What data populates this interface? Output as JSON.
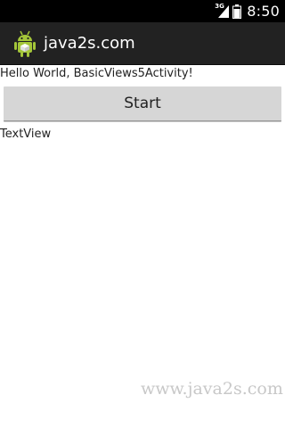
{
  "status_bar": {
    "network_type": "3G",
    "time": "8:50",
    "icons": [
      "signal-icon",
      "battery-icon"
    ]
  },
  "action_bar": {
    "app_icon": "android-robot-icon",
    "title": "java2s.com"
  },
  "content": {
    "hello_text": "Hello World, BasicViews5Activity!",
    "start_button_label": "Start",
    "text_view": "TextView"
  },
  "watermark": "www.java2s.com",
  "colors": {
    "status_bar_bg": "#000000",
    "action_bar_bg": "#222222",
    "button_bg": "#d6d6d6",
    "android_green": "#a4c639"
  }
}
